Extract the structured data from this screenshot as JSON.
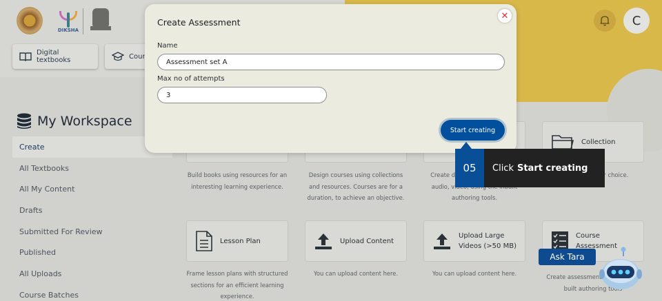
{
  "header": {
    "logo_text_diksha": "DIKSHA",
    "nav_buttons": [
      {
        "label": "Digital textbooks",
        "icon": "book-icon"
      },
      {
        "label": "Cours",
        "icon": "graduation-cap-icon"
      }
    ],
    "avatar_initial": "C"
  },
  "workspace": {
    "title": "My Workspace",
    "menu": [
      "Create",
      "All Textbooks",
      "All My Content",
      "Drafts",
      "Submitted For Review",
      "Published",
      "All Uploads",
      "Course Batches"
    ],
    "active_item": "Create"
  },
  "cards": {
    "row1": {
      "collection_label": "Collection",
      "descs": [
        "Build books using resources for an interesting learning experience.",
        "Design courses using collections and resources. Courses are for a duration, to achieve an objective.",
        "Create d story, game, activity, audio, video, using the inbuilt authoring tools.",
        "your choice."
      ]
    },
    "row2": [
      {
        "label": "Lesson Plan",
        "icon": "document-icon",
        "desc": "Frame lesson plans with structured sections for an efficient learning experience."
      },
      {
        "label": "Upload Content",
        "icon": "upload-icon",
        "desc": "You can upload content here."
      },
      {
        "label": "Upload Large Videos (>50 MB)",
        "icon": "upload-icon",
        "desc": "You can upload content here."
      },
      {
        "label": "Course Assessment",
        "icon": "checklist-icon",
        "desc": "Create assessment using the in-built authoring tools"
      }
    ]
  },
  "modal": {
    "title": "Create Assessment",
    "name_label": "Name",
    "name_value": "Assessment set A",
    "attempts_label": "Max no of attempts",
    "attempts_value": "3",
    "submit_label": "Start creating",
    "close_glyph": "✕"
  },
  "tooltip": {
    "step": "05",
    "prefix": "Click",
    "action": "Start creating"
  },
  "assistant": {
    "label": "Ask Tara"
  },
  "colors": {
    "accent": "#024f9d",
    "banner": "#d9b84a",
    "modal_bg": "#ebebdf",
    "close": "#e03030"
  }
}
